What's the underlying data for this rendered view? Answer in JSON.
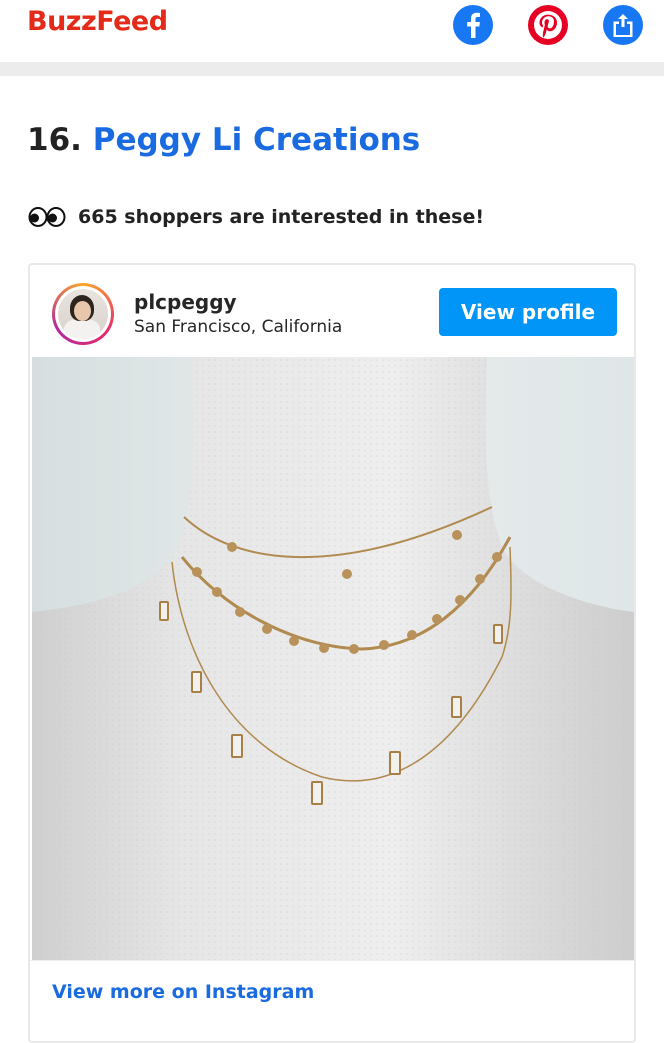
{
  "header": {
    "logo": "BuzzFeed",
    "share_icons": [
      "facebook-icon",
      "pinterest-icon",
      "share-icon"
    ],
    "colors": {
      "logo": "#e42a18",
      "facebook": "#1877f2",
      "pinterest": "#e60023",
      "share": "#1877f2"
    }
  },
  "article": {
    "number": "16.",
    "title_link": "Peggy Li Creations",
    "interest_icon": "eyes-icon",
    "interest_text": "665 shoppers are interested in these!"
  },
  "instagram_embed": {
    "username": "plcpeggy",
    "location": "San Francisco, California",
    "view_profile_label": "View profile",
    "image_subject": "three-layered-gold-necklaces-on-mannequin",
    "view_more_label": "View more on Instagram",
    "colors": {
      "button": "#0095f6",
      "link": "#1a6ae0"
    }
  }
}
